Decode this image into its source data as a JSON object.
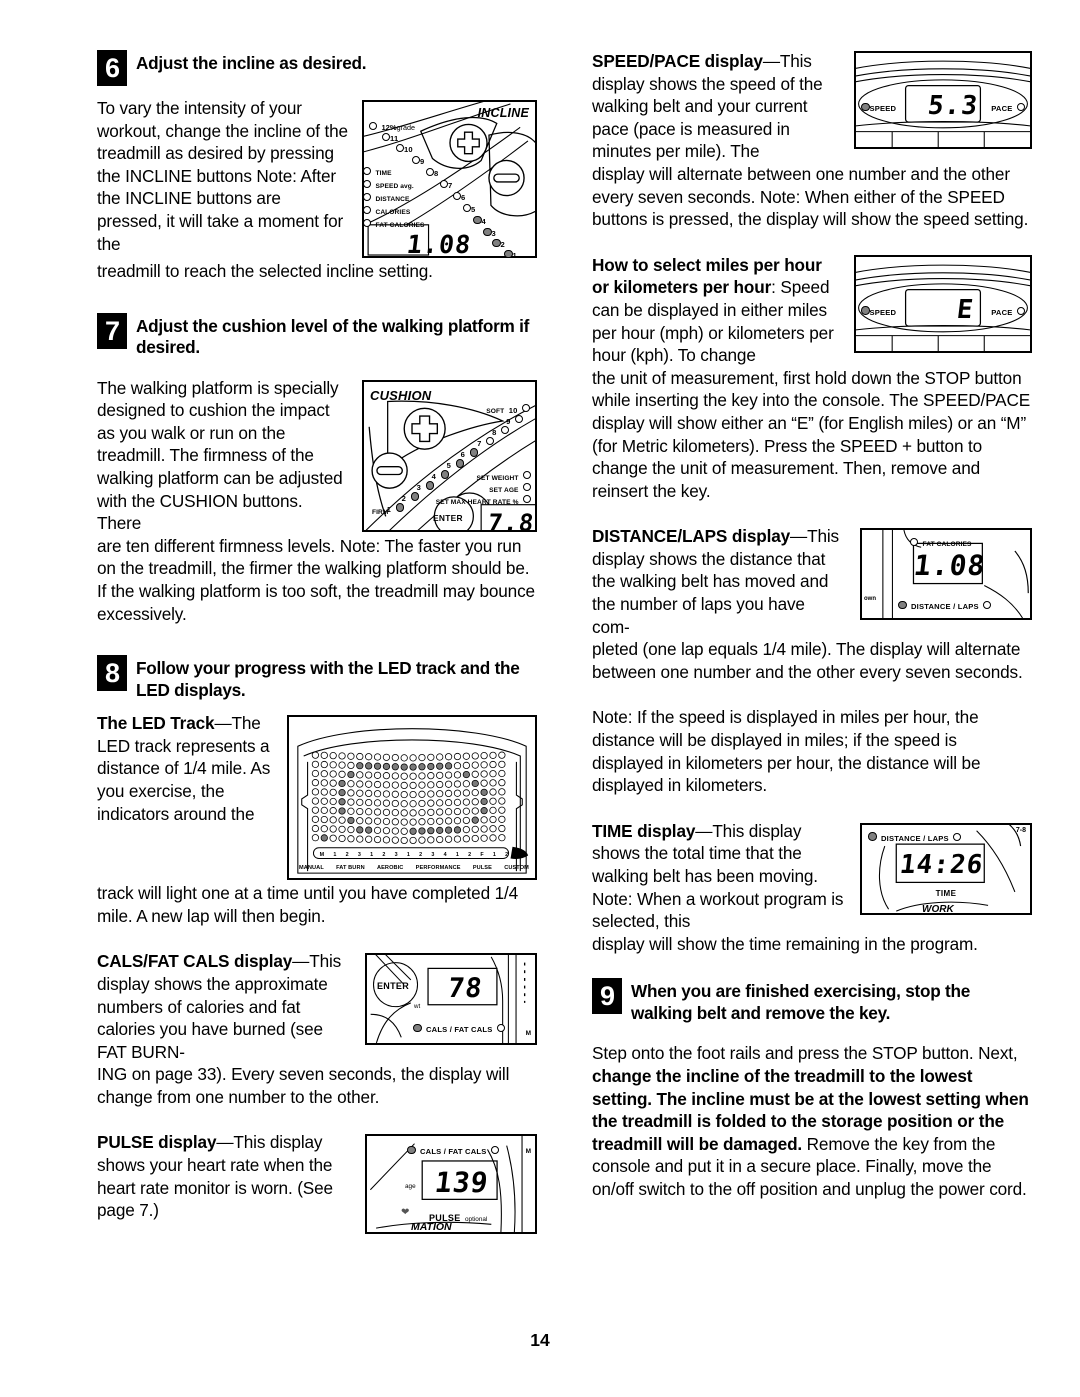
{
  "document": {
    "page_number": "14"
  },
  "left_column": {
    "step6": {
      "number": "6",
      "title": "Adjust the incline as desired.",
      "para_wrap": "To vary the intensity of your workout, change the incline of the treadmill as desired by pressing the INCLINE buttons Note: After the INCLINE buttons are pressed, it will take a moment for the",
      "para_tail": "treadmill to reach the selected incline setting.",
      "figure": {
        "name": "incline-console-diagram",
        "title": "INCLINE",
        "grade_label": "12%",
        "grade_unit": "grade",
        "levels": [
          "11",
          "10",
          "9",
          "8",
          "7",
          "6",
          "5",
          "4",
          "3",
          "2",
          "1"
        ],
        "lit_levels": [
          "4",
          "3",
          "2",
          "1"
        ],
        "side_labels": [
          "TIME",
          "SPEED avg.",
          "DISTANCE",
          "CALORIES",
          "FAT CALORIES"
        ],
        "lcd_value": "1.08",
        "plus_button": "+",
        "minus_button": "-"
      }
    },
    "step7": {
      "number": "7",
      "title": "Adjust the cushion level of the walking platform if desired.",
      "para_wrap": "The walking platform is specially designed to cushion the impact as you walk or run on the treadmill. The firmness of the walking platform can be adjusted with the CUSHION buttons. There",
      "para_tail": "are ten different firmness levels. Note: The faster you run on the treadmill, the firmer the walking platform should be. If the walking platform is too soft, the treadmill may bounce excessively.",
      "figure": {
        "name": "cushion-console-diagram",
        "title": "CUSHION",
        "soft_label": "SOFT",
        "firm_label": "FIRM",
        "levels": [
          "10",
          "9",
          "8",
          "7",
          "6",
          "5",
          "4",
          "3",
          "2",
          "1"
        ],
        "lit_levels": [
          "6",
          "5",
          "4",
          "3",
          "2",
          "1"
        ],
        "side_labels": [
          "SET WEIGHT",
          "SET AGE",
          "SET MAX HEART RATE %"
        ],
        "enter_button": "ENTER",
        "lcd_value": "7.8",
        "plus_button": "+",
        "minus_button": "-"
      }
    },
    "step8": {
      "number": "8",
      "title": "Follow your progress with the LED track and the LED displays.",
      "led_track": {
        "heading_bold": "The LED Track",
        "heading_dash": "—",
        "para_wrap": "The LED track represents a distance of 1/4 mile. As you exercise, the indicators around the",
        "para_tail": "track will light one at a time until you have completed 1/4 mile. A new lap will then begin.",
        "figure": {
          "name": "led-track-diagram",
          "program_labels": [
            "MANUAL",
            "FAT BURN",
            "AEROBIC",
            "PERFORMANCE",
            "PULSE",
            "CUSTOM"
          ],
          "column_keys": [
            "M",
            "1",
            "2",
            "3",
            "1",
            "2",
            "3",
            "1",
            "2",
            "3",
            "4",
            "1",
            "2",
            "F",
            "1",
            "2"
          ],
          "rows": 10,
          "cols": 22
        }
      },
      "cals": {
        "heading_bold": "CALS/FAT CALS display",
        "heading_dash": "—",
        "para_wrap": "This display shows the approximate numbers of calories and fat calories you have burned (see FAT BURN-",
        "para_tail": "ING on page 33). Every seven seconds, the display will change from one number to the other.",
        "figure": {
          "name": "cals-fat-cals-display-diagram",
          "enter_button": "ENTER",
          "wt_label": "wt",
          "lcd_value": "78",
          "label": "CALS  /  FAT CALS",
          "m_label": "M"
        }
      },
      "pulse": {
        "heading_bold": "PULSE display",
        "heading_dash": "—",
        "para_wrap": "This display shows your heart rate when the heart rate monitor is worn. (See page 7.)",
        "figure": {
          "name": "pulse-display-diagram",
          "top_label": "CALS  /  FAT CALS",
          "age_label": "age",
          "lcd_value": "139",
          "pulse_label": "PULSE",
          "optional_label": "optional",
          "bottom_label": "MATION",
          "m_label": "M"
        }
      }
    }
  },
  "right_column": {
    "speed_pace": {
      "heading_bold": "SPEED/PACE display",
      "heading_dash": "—",
      "para_wrap": "This display shows the speed of the walking belt and your current pace (pace is measured in minutes per mile). The",
      "para_tail": "display will alternate between one number and the other every seven seconds. Note: When either of the SPEED buttons is pressed, the display will show the speed setting.",
      "figure": {
        "name": "speed-pace-display-diagram",
        "speed_label": "SPEED",
        "pace_label": "PACE",
        "lcd_value": "5.3"
      }
    },
    "units": {
      "heading_bold": "How to select miles per hour or kilometers per hour",
      "heading_colon": ":",
      "para_wrap": "Speed can be displayed in either miles per hour (mph) or kilometers per hour (kph). To change",
      "para_tail": "the unit of measurement, first hold down the STOP button while inserting the key into the console. The SPEED/PACE display will show either an “E” (for English miles) or an “M” (for Metric kilometers). Press the SPEED + button to change the unit of measurement. Then, remove and reinsert the key.",
      "figure": {
        "name": "speed-pace-unit-display-diagram",
        "speed_label": "SPEED",
        "pace_label": "PACE",
        "lcd_value": "E"
      }
    },
    "distance_laps": {
      "heading_bold": "DISTANCE/LAPS display",
      "heading_dash": "—",
      "para_wrap": "This display shows the distance that the walking belt has moved and the number of laps you have com-",
      "para_tail": "pleted (one lap equals 1/4 mile). The display will alternate between one number and the other every seven seconds.",
      "note": "Note: If the speed is displayed in miles per hour, the distance will be displayed in miles; if the speed is displayed in kilometers per hour, the distance will be displayed in kilometers.",
      "figure": {
        "name": "distance-laps-display-diagram",
        "fat_calories_label": "FAT CALORIES",
        "side_label": "own",
        "lcd_value": "1.08",
        "label": "DISTANCE / LAPS"
      }
    },
    "time": {
      "heading_bold": "TIME display",
      "heading_dash": "—",
      "para_wrap": "This display shows the total time that the walking belt has been moving. Note: When a workout program is selected, this",
      "para_tail": "display will show the time remaining in the program.",
      "figure": {
        "name": "time-display-diagram",
        "top_label": "DISTANCE / LAPS",
        "corner_label": "7-8",
        "lcd_value": "14:26",
        "time_label": "TIME",
        "bottom_label": "WORK"
      }
    },
    "step9": {
      "number": "9",
      "title": "When you are finished exercising, stop the walking belt and remove the key.",
      "para_a": "Step onto the foot rails and press the STOP button. Next, ",
      "para_b_bold": "change the incline of the treadmill to the lowest setting. The incline must be at the lowest setting when the treadmill is folded to the storage position or the treadmill will be damaged.",
      "para_c": " Remove the key from the console and put it in a secure place. Finally, move the on/off switch to the off position and unplug the power cord."
    }
  }
}
